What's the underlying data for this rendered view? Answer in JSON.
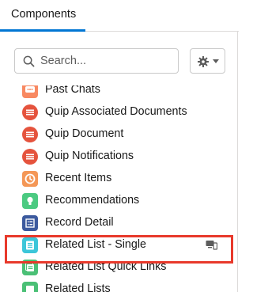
{
  "header": {
    "tab_label": "Components"
  },
  "search": {
    "placeholder": "Search...",
    "value": ""
  },
  "toolbar": {
    "settings_icon": "gear-icon",
    "dropdown_icon": "chevron-down-icon"
  },
  "components": [
    {
      "label": "Past Chats",
      "icon": "chat-icon",
      "color": "#f88962"
    },
    {
      "label": "Quip Associated Documents",
      "icon": "quip-icon",
      "color": "#e5533d"
    },
    {
      "label": "Quip Document",
      "icon": "quip-icon",
      "color": "#e5533d"
    },
    {
      "label": "Quip Notifications",
      "icon": "quip-icon",
      "color": "#e5533d"
    },
    {
      "label": "Recent Items",
      "icon": "clock-icon",
      "color": "#f49756"
    },
    {
      "label": "Recommendations",
      "icon": "lightbulb-icon",
      "color": "#4bca81"
    },
    {
      "label": "Record Detail",
      "icon": "list-icon",
      "color": "#3c5a9e"
    },
    {
      "label": "Related List - Single",
      "icon": "related-list-icon",
      "color": "#3cc6d9",
      "selected": true
    },
    {
      "label": "Related List Quick Links",
      "icon": "quick-links-icon",
      "color": "#4bc076"
    },
    {
      "label": "Related Lists",
      "icon": "related-lists-icon",
      "color": "#4bc076"
    }
  ],
  "colors": {
    "accent": "#0176d3",
    "highlight": "#e8392b"
  }
}
